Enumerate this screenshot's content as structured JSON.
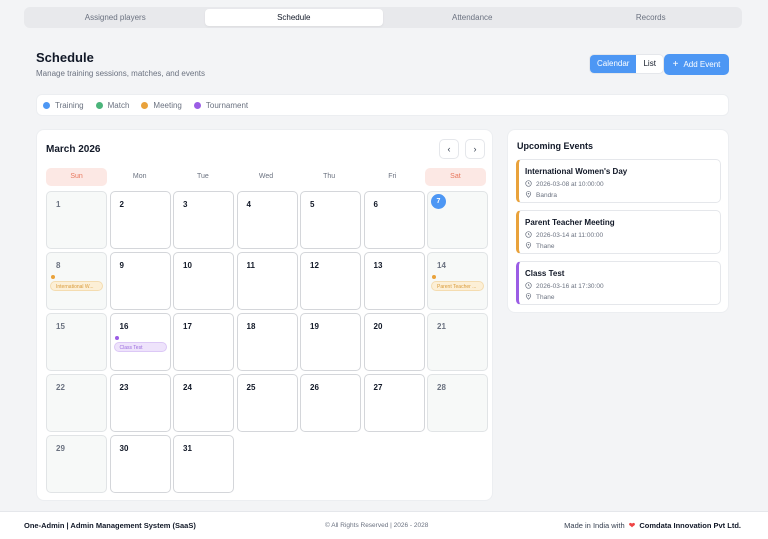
{
  "tabs": [
    {
      "label": "Assigned players",
      "active": false
    },
    {
      "label": "Schedule",
      "active": true
    },
    {
      "label": "Attendance",
      "active": false
    },
    {
      "label": "Records",
      "active": false
    }
  ],
  "header": {
    "title": "Schedule",
    "subtitle": "Manage training sessions, matches, and events",
    "view_calendar": "Calendar",
    "view_list": "List",
    "add_event": "Add Event"
  },
  "legend": [
    {
      "label": "Training",
      "color": "#4d97f4"
    },
    {
      "label": "Match",
      "color": "#4bb47a"
    },
    {
      "label": "Meeting",
      "color": "#e9a23b"
    },
    {
      "label": "Tournament",
      "color": "#9b5de5"
    }
  ],
  "calendar": {
    "month_label": "March 2026",
    "days_of_week": [
      "Sun",
      "Mon",
      "Tue",
      "Wed",
      "Thu",
      "Fri",
      "Sat"
    ],
    "weeks": [
      [
        "1",
        "2",
        "3",
        "4",
        "5",
        "6",
        "7"
      ],
      [
        "8",
        "9",
        "10",
        "11",
        "12",
        "13",
        "14"
      ],
      [
        "15",
        "16",
        "17",
        "18",
        "19",
        "20",
        "21"
      ],
      [
        "22",
        "23",
        "24",
        "25",
        "26",
        "27",
        "28"
      ],
      [
        "29",
        "30",
        "31",
        "",
        "",
        "",
        ""
      ]
    ],
    "today": "7",
    "events": [
      {
        "day": "8",
        "label": "International W...",
        "type": "meeting"
      },
      {
        "day": "14",
        "label": "Parent Teacher ...",
        "type": "meeting"
      },
      {
        "day": "16",
        "label": "Class Test",
        "type": "tournament"
      }
    ]
  },
  "upcoming": {
    "title": "Upcoming Events",
    "items": [
      {
        "name": "International Women's Day",
        "when": "2026-03-08 at 10:00:00",
        "place": "Bandra",
        "color": "#e9a23b"
      },
      {
        "name": "Parent Teacher Meeting",
        "when": "2026-03-14 at 11:00:00",
        "place": "Thane",
        "color": "#e9a23b"
      },
      {
        "name": "Class Test",
        "when": "2026-03-16 at 17:30:00",
        "place": "Thane",
        "color": "#9b5de5"
      }
    ]
  },
  "footer": {
    "left": "One-Admin | Admin Management System (SaaS)",
    "middle": "© All Rights Reserved | 2026 - 2028",
    "right_prefix": "Made in India with",
    "right_company": "Comdata Innovation Pvt Ltd."
  },
  "icons": {
    "heart": "heart-icon",
    "clock": "clock-icon",
    "pin": "map-pin-icon",
    "plus": "plus-icon"
  }
}
